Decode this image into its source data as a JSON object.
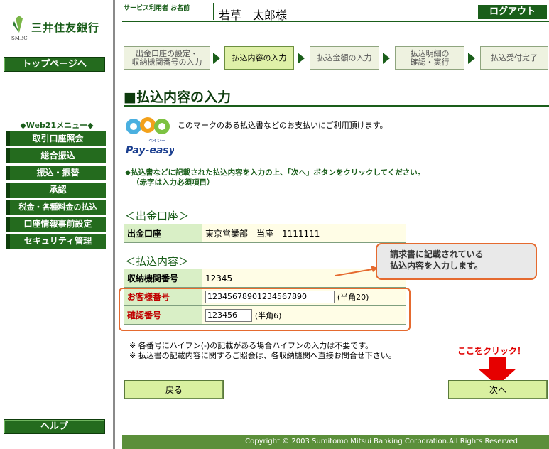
{
  "brand": {
    "name": "三井住友銀行",
    "sub": "SMBC"
  },
  "sidebar": {
    "top_button": "トップページへ",
    "menu_title": "◆Web21メニュー◆",
    "items": [
      {
        "label": "取引口座照会"
      },
      {
        "label": "総合振込"
      },
      {
        "label": "振込・振替"
      },
      {
        "label": "承認"
      },
      {
        "label": "税金・各種料金の払込"
      },
      {
        "label": "口座情報事前設定"
      },
      {
        "label": "セキュリティ管理"
      }
    ],
    "help_button": "ヘルプ"
  },
  "header": {
    "user_label": "サービス利用者 お名前",
    "user_name": "若草　太郎様",
    "logout": "ログアウト"
  },
  "steps": [
    {
      "label": "出金口座の設定・\n収納機関番号の入力",
      "active": false
    },
    {
      "label": "払込内容の入力",
      "active": true
    },
    {
      "label": "払込金額の入力",
      "active": false
    },
    {
      "label": "払込明細の\n確認・実行",
      "active": false
    },
    {
      "label": "払込受付完了",
      "active": false
    }
  ],
  "page_title": "■払込内容の入力",
  "payeasy": {
    "logo_text": "Pay-easy",
    "logo_kana": "ペイジー",
    "description": "このマークのある払込書などのお支払いにご利用頂けます。"
  },
  "instruction": {
    "line1": "◆払込書などに記載された払込内容を入力の上、「次へ」ボタンをクリックしてください。",
    "line2": "（赤字は入力必須項目）"
  },
  "account_section": {
    "heading": "＜出金口座＞",
    "label": "出金口座",
    "value": "東京営業部　当座　1111111"
  },
  "payment_section": {
    "heading": "＜払込内容＞",
    "institution_label": "収納機関番号",
    "institution_value": "12345",
    "customer_label": "お客様番号",
    "customer_value": "12345678901234567890",
    "customer_hint": "(半角20)",
    "confirm_label": "確認番号",
    "confirm_value": "123456",
    "confirm_hint": "(半角6)"
  },
  "callout": {
    "line1": "請求書に記載されている",
    "line2": "払込内容を入力します。"
  },
  "notes": [
    "※ 各番号にハイフン(-)の記載がある場合ハイフンの入力は不要です。",
    "※ 払込書の記載内容に関するご照会は、各収納機関へ直接お問合せ下さい。"
  ],
  "buttons": {
    "back": "戻る",
    "next": "次へ"
  },
  "click_here": "ここをクリック！",
  "footer": "Copyright © 2003 Sumitomo Mitsui Banking Corporation.All Rights Reserved",
  "colors": {
    "brand_green": "#1a5e1a",
    "highlight": "#e56a2f",
    "required_red": "#c00000"
  }
}
